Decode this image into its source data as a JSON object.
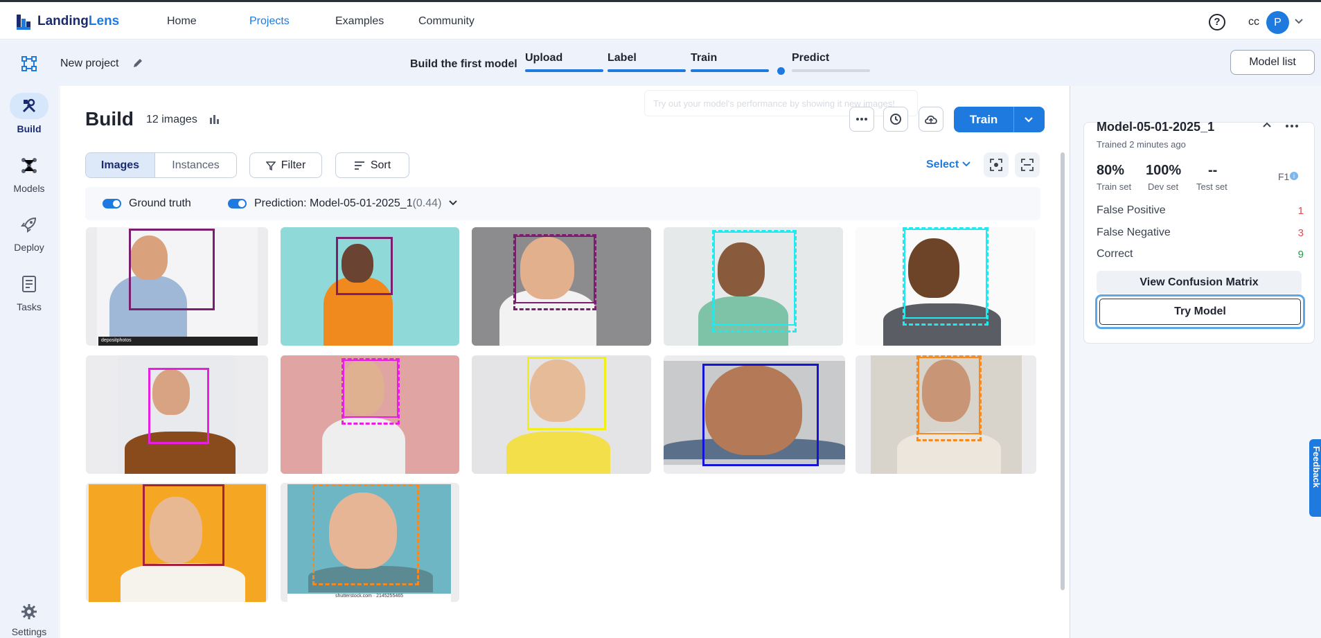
{
  "app": {
    "logo_name": "LandingLens",
    "nav": [
      "Home",
      "Projects",
      "Examples",
      "Community"
    ],
    "active_nav": "Projects",
    "help_glyph": "?",
    "org": "cc",
    "avatar_initial": "P",
    "accent": "#1f7ae0"
  },
  "project": {
    "name": "New project",
    "steps_title": "Build the first model",
    "steps": [
      "Upload",
      "Label",
      "Train",
      "Predict"
    ],
    "model_list_label": "Model list"
  },
  "sidebar": {
    "items": [
      {
        "label": "Build",
        "icon": "build-tools-icon"
      },
      {
        "label": "Models",
        "icon": "models-network-icon"
      },
      {
        "label": "Deploy",
        "icon": "rocket-icon"
      },
      {
        "label": "Tasks",
        "icon": "tasks-list-icon"
      }
    ],
    "settings_label": "Settings"
  },
  "build": {
    "title": "Build",
    "image_count": "12 images",
    "tooltip_hint": "Try out your model's performance by showing it new images!",
    "train_label": "Train",
    "tabs": [
      "Images",
      "Instances"
    ],
    "active_tab": "Images",
    "filter_label": "Filter",
    "sort_label": "Sort",
    "select_label": "Select",
    "ground_truth_label": "Ground truth",
    "prediction_label": "Prediction: Model-05-01-2025_1",
    "prediction_score": "(0.44)",
    "watermark_1": "depositphotos",
    "watermark_2": "shutterstock.com · 2145255465"
  },
  "images": [
    {
      "bg": "#f4f4f6",
      "box": "#7b1e6e",
      "dashed": false
    },
    {
      "bg": "#8fdad8",
      "box": "#7b1e6e",
      "dashed": false
    },
    {
      "bg": "#8c8c8e",
      "box": "#7b1e6e",
      "dashed": true
    },
    {
      "bg": "#e6e9ea",
      "box": "#22e8f0",
      "dashed": true
    },
    {
      "bg": "#fafafa",
      "box": "#22e8f0",
      "dashed": true
    },
    {
      "bg": "#e8eaee",
      "box": "#e81ee0",
      "dashed": false
    },
    {
      "bg": "#e0a4a2",
      "box": "#e81ee0",
      "dashed": true
    },
    {
      "bg": "#e4e4e6",
      "box": "#f2ee1a",
      "dashed": false
    },
    {
      "bg": "#c8cacc",
      "box": "#1414d6",
      "dashed": false
    },
    {
      "bg": "#d8d4cc",
      "box": "#f58a22",
      "dashed": true
    },
    {
      "bg": "#f5a623",
      "box": "#a6203a",
      "dashed": false
    },
    {
      "bg": "#6fb6c4",
      "box": "#f58a22",
      "dashed": true
    }
  ],
  "model_panel": {
    "name": "Model-05-01-2025_1",
    "trained": "Trained 2 minutes ago",
    "train_pct": "80%",
    "train_lbl": "Train set",
    "dev_pct": "100%",
    "dev_lbl": "Dev set",
    "test_pct": "--",
    "test_lbl": "Test set",
    "f1_label": "F1",
    "false_positive_label": "False Positive",
    "false_positive": "1",
    "false_negative_label": "False Negative",
    "false_negative": "3",
    "correct_label": "Correct",
    "correct": "9",
    "confusion_label": "View Confusion Matrix",
    "try_label": "Try Model",
    "feedback_label": "Feedback"
  }
}
